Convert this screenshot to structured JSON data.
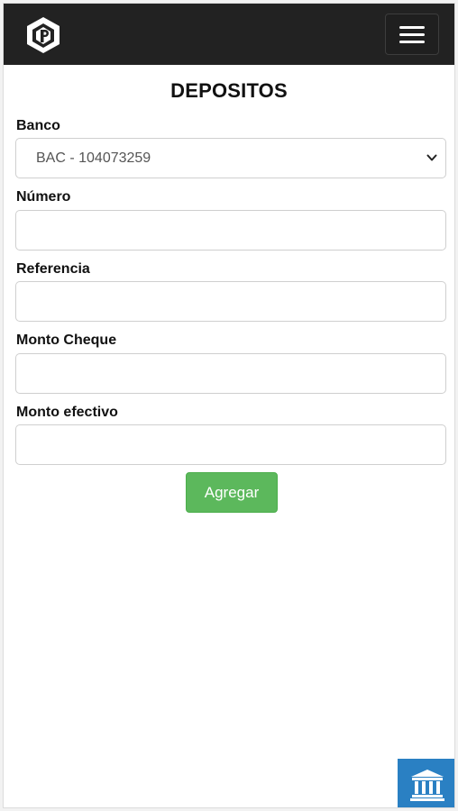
{
  "page": {
    "title": "DEPOSITOS"
  },
  "form": {
    "banco": {
      "label": "Banco",
      "selected": "BAC - 104073259"
    },
    "numero": {
      "label": "Número",
      "value": ""
    },
    "referencia": {
      "label": "Referencia",
      "value": ""
    },
    "monto_cheque": {
      "label": "Monto Cheque",
      "value": ""
    },
    "monto_efectivo": {
      "label": "Monto efectivo",
      "value": ""
    },
    "submit_label": "Agregar"
  },
  "icons": {
    "logo": "app-logo-icon",
    "menu": "hamburger-menu-icon",
    "select_arrow": "chevron-down-icon",
    "bank": "bank-icon"
  },
  "colors": {
    "navbar": "#222222",
    "primary_button": "#5cb85c",
    "fab": "#2a80c3"
  }
}
